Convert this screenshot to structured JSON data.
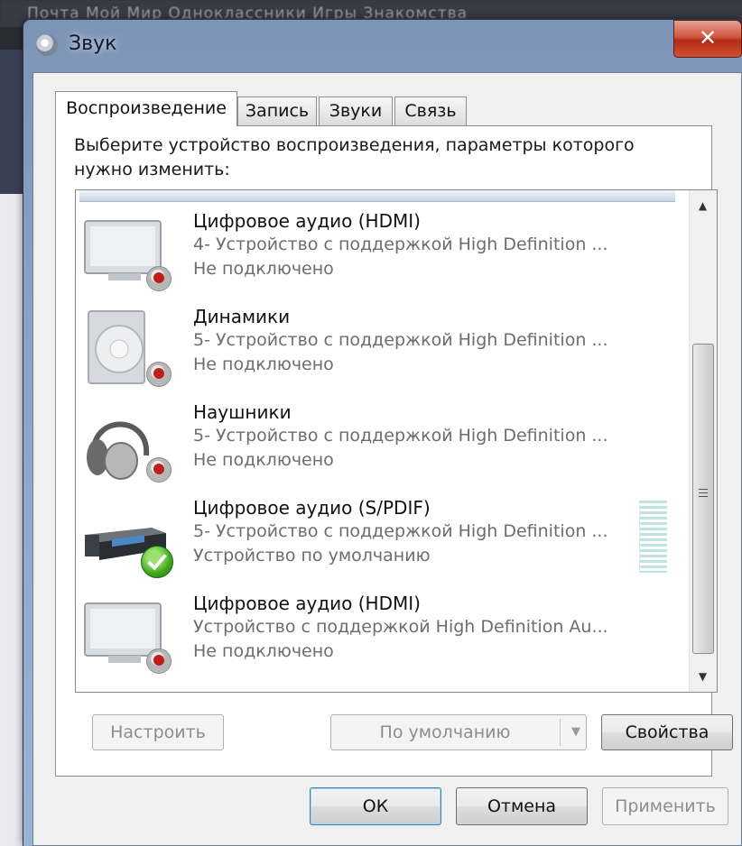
{
  "background": {
    "menu_text": "Почта  Мой Мир  Одноклассники  Игры  Знакомства"
  },
  "window": {
    "title": "Звук",
    "close_glyph": "✕"
  },
  "tabs": [
    {
      "label": "Воспроизведение",
      "active": true
    },
    {
      "label": "Запись",
      "active": false
    },
    {
      "label": "Звуки",
      "active": false
    },
    {
      "label": "Связь",
      "active": false
    }
  ],
  "instruction": "Выберите устройство воспроизведения, параметры которого нужно изменить:",
  "devices": [
    {
      "name": "Цифровое аудио (HDMI)",
      "description": "4- Устройство с поддержкой High Definition ...",
      "status": "Не подключено",
      "icon": "monitor-icon",
      "state": "disconnected"
    },
    {
      "name": "Динамики",
      "description": "5- Устройство с поддержкой High Definition ...",
      "status": "Не подключено",
      "icon": "speaker-icon",
      "state": "disconnected"
    },
    {
      "name": "Наушники",
      "description": "5- Устройство с поддержкой High Definition ...",
      "status": "Не подключено",
      "icon": "headphones-icon",
      "state": "disconnected"
    },
    {
      "name": "Цифровое аудио (S/PDIF)",
      "description": "5- Устройство с поддержкой High Definition ...",
      "status": "Устройство по умолчанию",
      "icon": "receiver-icon",
      "state": "default"
    },
    {
      "name": "Цифровое аудио (HDMI)",
      "description": "Устройство с поддержкой High Definition Au...",
      "status": "Не подключено",
      "icon": "monitor-icon",
      "state": "disconnected"
    }
  ],
  "panel_buttons": {
    "configure": "Настроить",
    "set_default": "По умолчанию",
    "properties": "Свойства"
  },
  "dialog_buttons": {
    "ok": "ОК",
    "cancel": "Отмена",
    "apply": "Применить"
  },
  "colors": {
    "disconnected_badge": "#c0201a",
    "default_check": "#3da71e",
    "title_bar": "#8ba4c6"
  }
}
